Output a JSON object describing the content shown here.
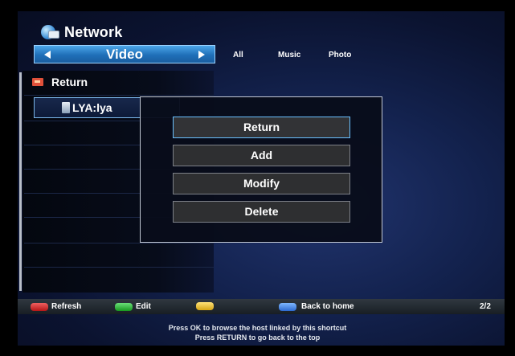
{
  "header": {
    "title": "Network"
  },
  "category": {
    "current": "Video"
  },
  "tabs": [
    "All",
    "Music",
    "Photo"
  ],
  "list": {
    "return_label": "Return",
    "items": [
      {
        "label": "LYA:lya"
      }
    ]
  },
  "popup": {
    "items": [
      "Return",
      "Add",
      "Modify",
      "Delete"
    ]
  },
  "footer": {
    "red_label": "Refresh",
    "green_label": "Edit",
    "yellow_label": "",
    "blue_label": "Back to home",
    "page": "2/2"
  },
  "hints": [
    "Press OK to browse the host linked by this shortcut",
    "Press RETURN to go back to the top"
  ]
}
